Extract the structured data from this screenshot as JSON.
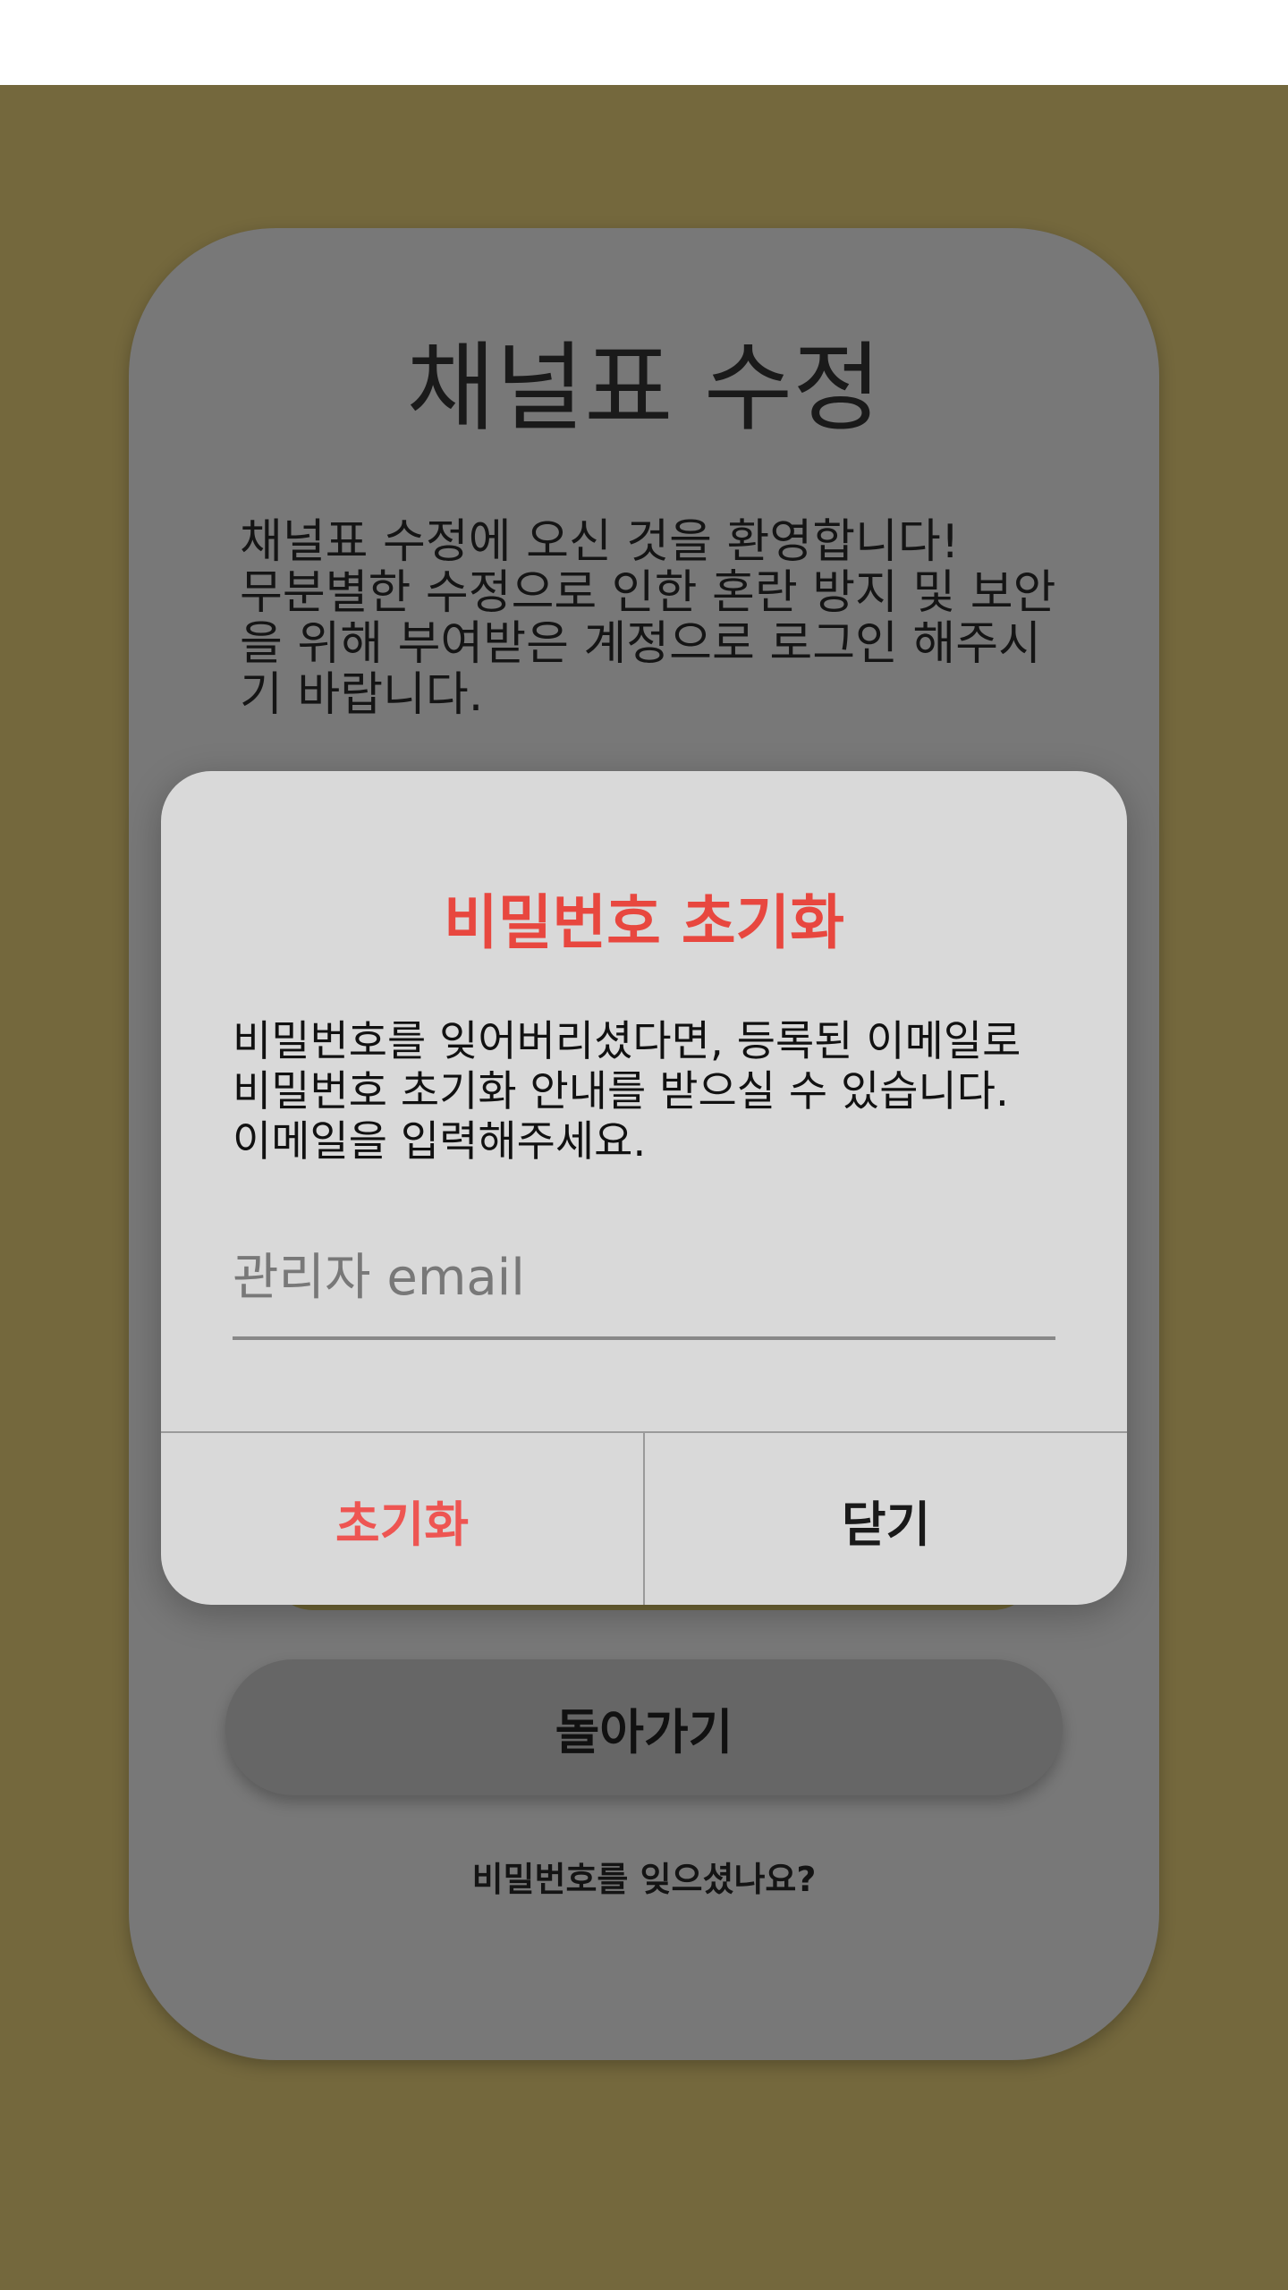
{
  "page": {
    "title": "채널표 수정",
    "description": "채널표 수정에 오신 것을 환영합니다!\n무분별한 수정으로 인한 혼란 방지 및 보안을 위해 부여받은 계정으로 로그인 해주시기 바랍니다.",
    "back_button_label": "돌아가기",
    "forgot_password_link": "비밀번호를 잊으셨나요?"
  },
  "dialog": {
    "title": "비밀번호 초기화",
    "message": "비밀번호를 잊어버리셨다면, 등록된 이메일로\n비밀번호 초기화 안내를 받으실 수 있습니다.\n이메일을 입력해주세요.",
    "email_placeholder": "관리자 email",
    "email_value": "",
    "reset_label": "초기화",
    "close_label": "닫기"
  },
  "colors": {
    "background": "#74683d",
    "card": "#787878",
    "dialog": "#d9d9d9",
    "accent_red": "#e8473f",
    "reset_text": "#ee5552"
  }
}
